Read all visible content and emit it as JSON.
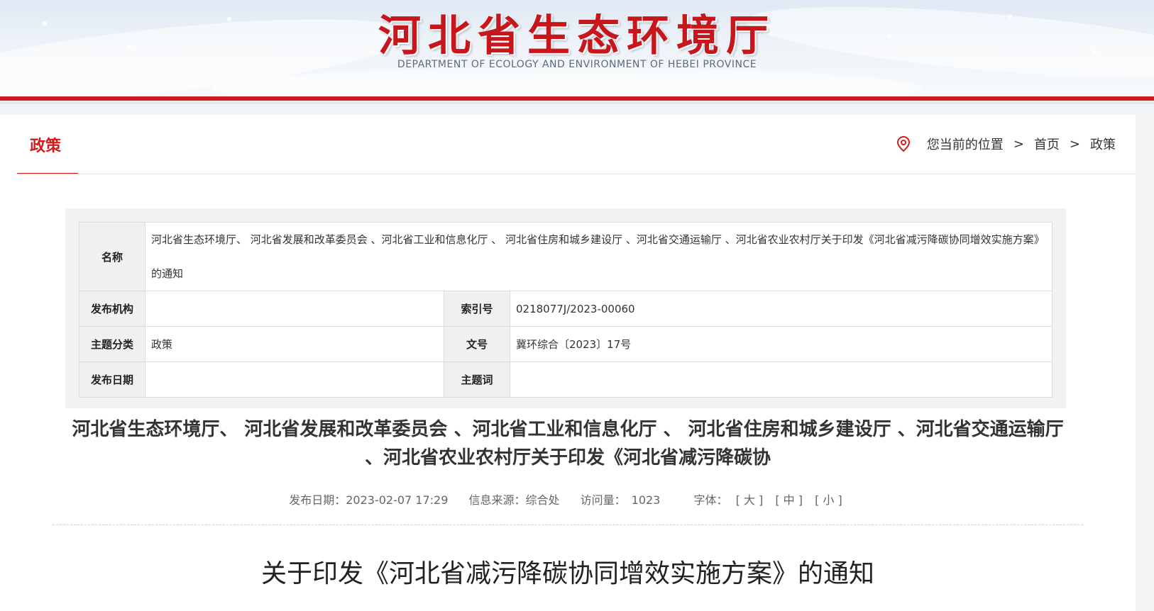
{
  "header": {
    "title": "河北省生态环境厅",
    "subtitle": "DEPARTMENT OF ECOLOGY AND ENVIRONMENT OF HEBEI PROVINCE",
    "accent_color": "#d21c1c"
  },
  "channel": {
    "title": "政策"
  },
  "breadcrumb": {
    "prefix": "您当前的位置",
    "separator": ">",
    "items": [
      "首页",
      "政策"
    ]
  },
  "info": {
    "name_label": "名称",
    "name_value": "河北省生态环境厅、 河北省发展和改革委员会 、河北省工业和信息化厅 、 河北省住房和城乡建设厅 、河北省交通运输厅 、河北省农业农村厅关于印发《河北省减污降碳协同增效实施方案》的通知",
    "publisher_label": "发布机构",
    "publisher_value": "",
    "index_label": "索引号",
    "index_value": "0218077J/2023-00060",
    "category_label": "主题分类",
    "category_value": "政策",
    "docno_label": "文号",
    "docno_value": "冀环综合〔2023〕17号",
    "date_label": "发布日期",
    "date_value": "",
    "keywords_label": "主题词",
    "keywords_value": ""
  },
  "article": {
    "title": "河北省生态环境厅、 河北省发展和改革委员会 、河北省工业和信息化厅 、 河北省住房和城乡建设厅 、河北省交通运输厅 、河北省农业农村厅关于印发《河北省减污降碳协",
    "meta": {
      "publish_date": "发布日期：2023-02-07 17:29",
      "source": "信息来源：综合处",
      "views_label": "访问量：",
      "views_value": "1023",
      "font_label": "字体：",
      "font_large": "[ 大 ]",
      "font_medium": "[ 中 ]",
      "font_small": "[ 小 ]"
    },
    "heading": "关于印发《河北省减污降碳协同增效实施方案》的通知"
  },
  "icons": {
    "location": "location-pin-icon"
  }
}
